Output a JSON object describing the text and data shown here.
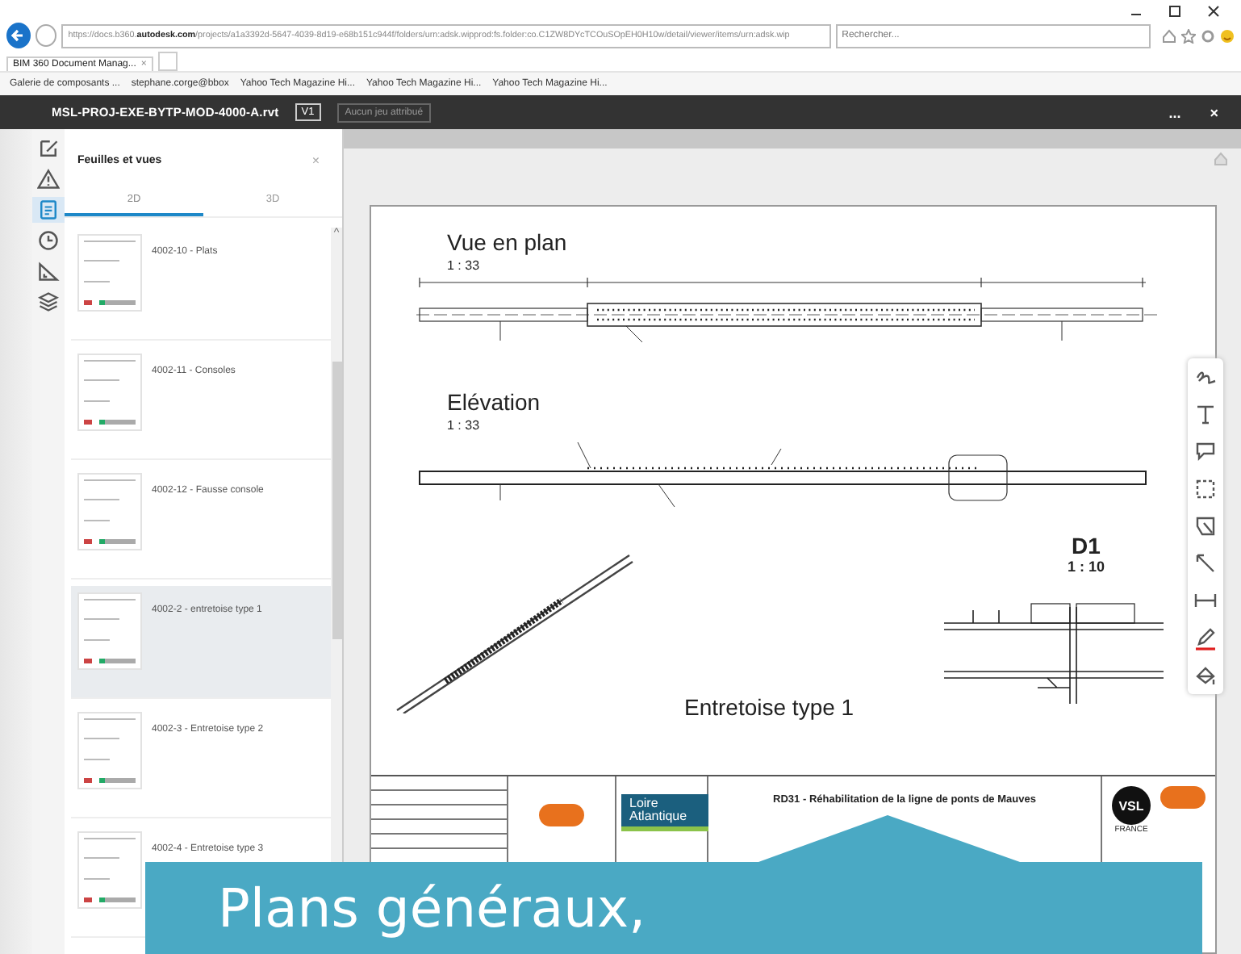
{
  "browser": {
    "url": "https://docs.b360.**autodesk.com**/projects/a1a3392d-5647-4039-8d19-e68b151c944f/folders/urn:adsk.wipprod:fs.folder:co.C1ZW8DYcTCOuSOpEH0H10w/detail/viewer/items/urn:adsk.wip",
    "search_placeholder": "Rechercher...",
    "tab": "BIM 360 Document Manag...",
    "tab_close": "×",
    "favorites": [
      "Galerie de composants ...",
      "stephane.corge@bbox",
      "Yahoo Tech  Magazine Hi...",
      "Yahoo Tech  Magazine Hi...",
      "Yahoo Tech  Magazine Hi..."
    ]
  },
  "header": {
    "file_name": "MSL-PROJ-EXE-BYTP-MOD-4000-A.rvt",
    "version": "V1",
    "set_button": "Aucun jeu attribué",
    "more": "...",
    "close": "×"
  },
  "rail": [
    {
      "kind": "markup",
      "selected": false
    },
    {
      "kind": "warning",
      "selected": false
    },
    {
      "kind": "sheets",
      "selected": true
    },
    {
      "kind": "clock",
      "selected": false
    },
    {
      "kind": "measure",
      "selected": false
    },
    {
      "kind": "layers",
      "selected": false
    }
  ],
  "panel": {
    "title": "Feuilles et vues",
    "close": "×",
    "tabs": [
      {
        "label": "2D",
        "selected": true
      },
      {
        "label": "3D",
        "selected": false
      }
    ],
    "items": [
      {
        "label": "4002-10 - Plats",
        "selected": false
      },
      {
        "label": "4002-11 - Consoles",
        "selected": false
      },
      {
        "label": "4002-12 - Fausse console",
        "selected": false
      },
      {
        "label": "4002-2 - entretoise type 1",
        "selected": true
      },
      {
        "label": "4002-3 - Entretoise type 2",
        "selected": false
      },
      {
        "label": "4002-4 - Entretoise type 3",
        "selected": false
      }
    ],
    "scroll_up": "^"
  },
  "sheet": {
    "plan_title": "Vue en plan",
    "plan_scale": "1 : 33",
    "elevation_title": "Elévation",
    "elevation_scale": "1 : 33",
    "detail_title": "D1",
    "detail_scale": "1 : 10",
    "view_title": "Entretoise type 1",
    "project_title": "RD31 - Réhabilitation de la ligne de ponts de Mauves",
    "client_logo": "Loire Atlantique",
    "partner_logo": "VSL",
    "partner_country": "FRANCE"
  },
  "tools": [
    {
      "kind": "freehand"
    },
    {
      "kind": "text"
    },
    {
      "kind": "callout"
    },
    {
      "kind": "rectangle"
    },
    {
      "kind": "polygon"
    },
    {
      "kind": "arrow"
    },
    {
      "kind": "dimension"
    },
    {
      "kind": "pen"
    },
    {
      "kind": "fill"
    }
  ],
  "callout": {
    "text": "Plans généraux,"
  }
}
